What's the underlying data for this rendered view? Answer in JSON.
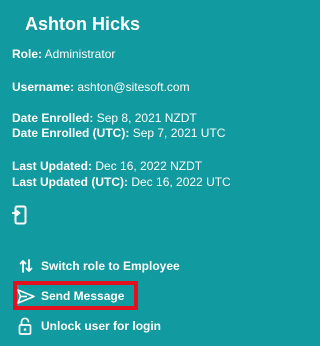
{
  "user": {
    "name": "Ashton Hicks"
  },
  "details": {
    "role": {
      "label": "Role:",
      "value": "Administrator"
    },
    "username": {
      "label": "Username:",
      "value": "ashton@sitesoft.com"
    },
    "date_enrolled": {
      "label": "Date Enrolled:",
      "value": "Sep 8, 2021 NZDT"
    },
    "date_enrolled_utc": {
      "label": "Date Enrolled (UTC):",
      "value": "Sep 7, 2021 UTC"
    },
    "last_updated": {
      "label": "Last Updated:",
      "value": "Dec 16, 2022 NZDT"
    },
    "last_updated_utc": {
      "label": "Last Updated (UTC):",
      "value": "Dec 16, 2022 UTC"
    }
  },
  "icons": {
    "device": "phone-login-icon",
    "switch": "swap-vertical-icon",
    "send": "send-icon",
    "unlock": "unlock-icon"
  },
  "actions": {
    "switch_role": "Switch role to Employee",
    "send_message": "Send Message",
    "unlock_user": "Unlock user for login"
  },
  "colors": {
    "background": "#119aa0",
    "text": "#ffffff",
    "highlight": "#e3101e"
  }
}
